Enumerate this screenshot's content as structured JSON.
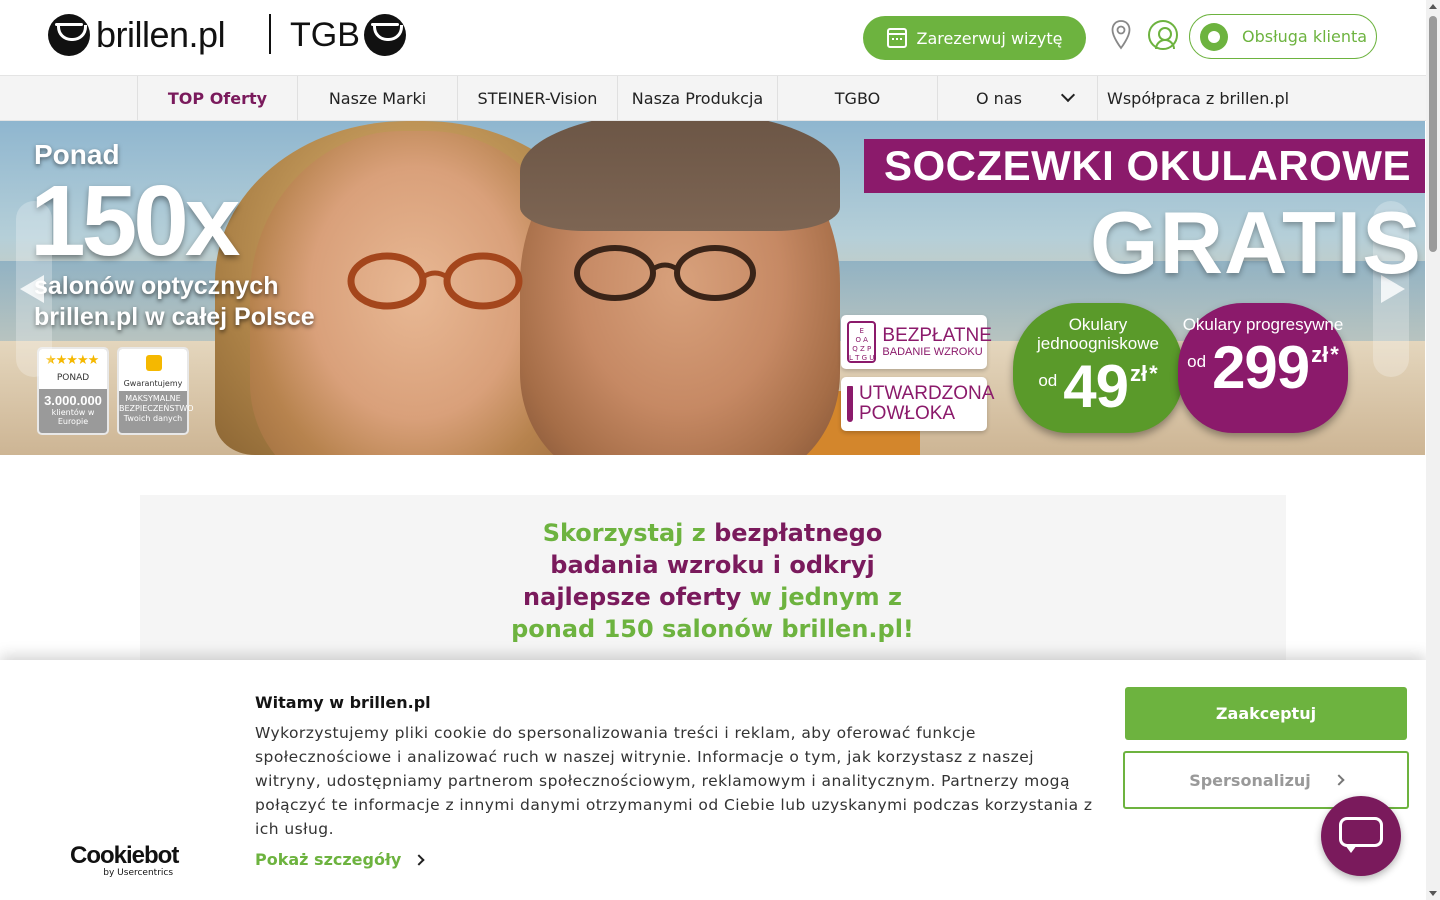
{
  "header": {
    "logo_brillen": "brillen.pl",
    "logo_tgb": "TGB",
    "visit_button": "Zarezerwuj wizytę",
    "service_button": "Obsługa klienta"
  },
  "nav": {
    "items": [
      {
        "label": "TOP Oferty"
      },
      {
        "label": "Nasze Marki"
      },
      {
        "label": "STEINER-Vision"
      },
      {
        "label": "Nasza Produkcja"
      },
      {
        "label": "TGBO"
      },
      {
        "label": "O nas"
      },
      {
        "label": "Współpraca z brillen.pl"
      }
    ]
  },
  "hero": {
    "ponad": "Ponad",
    "count": "150x",
    "salons": "salonów optycznych brillen.pl w całej Polsce",
    "badge_clients": {
      "top": "PONAD",
      "number": "3.000.000",
      "sub": "klientów w Europie"
    },
    "badge_security": {
      "top": "Gwarantujemy",
      "sub": "MAKSYMALNE BEZPIECZEŃSTWO Twoich danych"
    },
    "promo_title": "SOCZEWKI OKULAROWE",
    "promo_gratis": "GRATIS",
    "chip_exam": {
      "t1": "BEZPŁATNE",
      "t2": "BADANIE WZROKU",
      "chart": "E\nO A\nQ Z P\nL T G U"
    },
    "chip_coating": {
      "t1": "UTWARDZONA",
      "t2": "POWŁOKA"
    },
    "price_single": {
      "label": "Okulary jednoogniskowe",
      "od": "od",
      "value": "49",
      "unit": "zł",
      "star": "*"
    },
    "price_progressive": {
      "label": "Okulary progresywne",
      "od": "od",
      "value": "299",
      "unit": "zł",
      "star": "*"
    }
  },
  "info": {
    "part1": "Skorzystaj z ",
    "part2": "bezpłatnego badania wzroku i odkryj najlepsze oferty",
    "part3": " w jednym z ponad 150 salonów brillen.pl!"
  },
  "cookie": {
    "title": "Witamy w brillen.pl",
    "text": "Wykorzystujemy pliki cookie do spersonalizowania treści i reklam, aby oferować funkcje społecznościowe i analizować ruch w naszej witrynie. Informacje o tym, jak korzystasz z naszej witryny, udostępniamy partnerom społecznościowym, reklamowym i analitycznym. Partnerzy mogą połączyć te informacje z innymi danymi otrzymanymi od Ciebie lub uzyskanymi podczas korzystania z ich usług.",
    "details_link": "Pokaż szczegóły",
    "accept_button": "Zaakceptuj",
    "customize_button": "Spersonalizuj",
    "provider": "Cookiebot",
    "provider_sub": "by Usercentrics"
  },
  "colors": {
    "brand_green": "#6db33f",
    "brand_purple": "#7a1a5c",
    "promo_purple": "#8b1a6b",
    "price_green": "#5a9a2a"
  }
}
